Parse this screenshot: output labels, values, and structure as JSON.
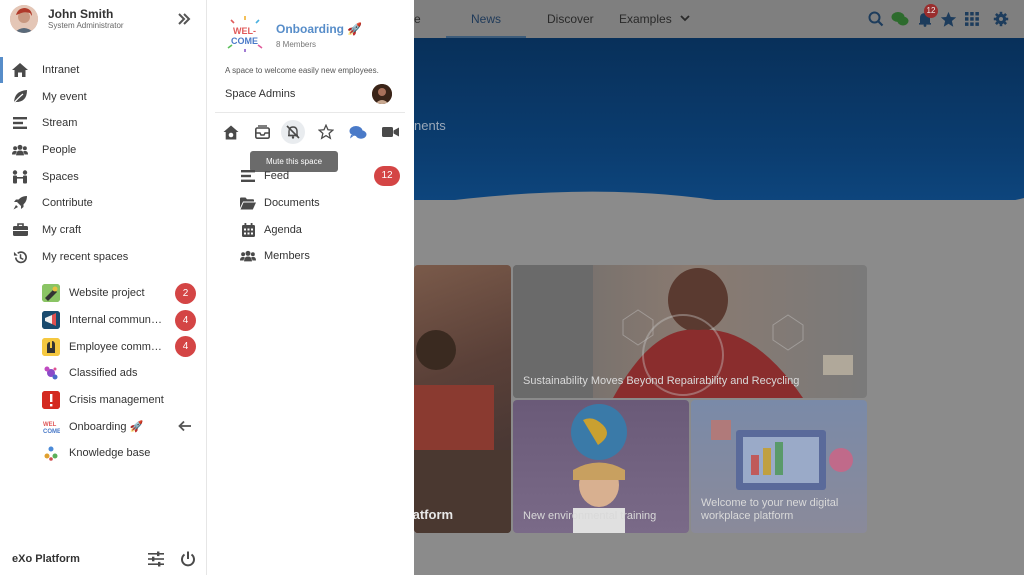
{
  "background": {
    "nav": [
      {
        "label": "e",
        "active": false
      },
      {
        "label": "News",
        "active": true
      },
      {
        "label": "Discover",
        "active": false
      },
      {
        "label": "Examples",
        "active": false
      }
    ],
    "banner_text": "nents",
    "notifications_count": "12",
    "tiles": [
      {
        "caption": "Sustainability Moves Beyond Repairability and Recycling"
      },
      {
        "caption": "New environmental training"
      },
      {
        "caption": "Welcome to your new digital workplace platform"
      },
      {
        "caption": "latform"
      }
    ]
  },
  "user": {
    "name": "John Smith",
    "role": "System Administrator"
  },
  "menu": [
    {
      "label": "Intranet",
      "icon": "home-icon",
      "active": true
    },
    {
      "label": "My event",
      "icon": "leaf-icon",
      "active": false
    },
    {
      "label": "Stream",
      "icon": "stream-icon",
      "active": false
    },
    {
      "label": "People",
      "icon": "people-icon",
      "active": false
    },
    {
      "label": "Spaces",
      "icon": "spaces-icon",
      "active": false
    },
    {
      "label": "Contribute",
      "icon": "rocket-icon",
      "active": false
    },
    {
      "label": "My craft",
      "icon": "briefcase-icon",
      "active": false
    }
  ],
  "recent": {
    "title": "My recent spaces",
    "spaces": [
      {
        "label": "Website project",
        "badge": "2"
      },
      {
        "label": "Internal communication",
        "badge": "4"
      },
      {
        "label": "Employee community",
        "badge": "4"
      },
      {
        "label": "Classified ads",
        "badge": ""
      },
      {
        "label": "Crisis management",
        "badge": ""
      },
      {
        "label": "Onboarding 🚀",
        "badge": ""
      },
      {
        "label": "Knowledge base",
        "badge": ""
      }
    ]
  },
  "footer": {
    "brand": "eXo Platform"
  },
  "space": {
    "name": "Onboarding 🚀",
    "members": "8 Members",
    "logo_line1": "WEL-",
    "logo_line2": "COME",
    "description": "A space to welcome easily new employees.",
    "admins_label": "Space Admins",
    "tooltip": "Mute this space",
    "nav": [
      {
        "label": "Feed",
        "badge": "12"
      },
      {
        "label": "Documents",
        "badge": ""
      },
      {
        "label": "Agenda",
        "badge": ""
      },
      {
        "label": "Members",
        "badge": ""
      }
    ]
  },
  "colors": {
    "accent": "#578dc9",
    "badge": "#d44545",
    "banner": "#0b3d70"
  }
}
